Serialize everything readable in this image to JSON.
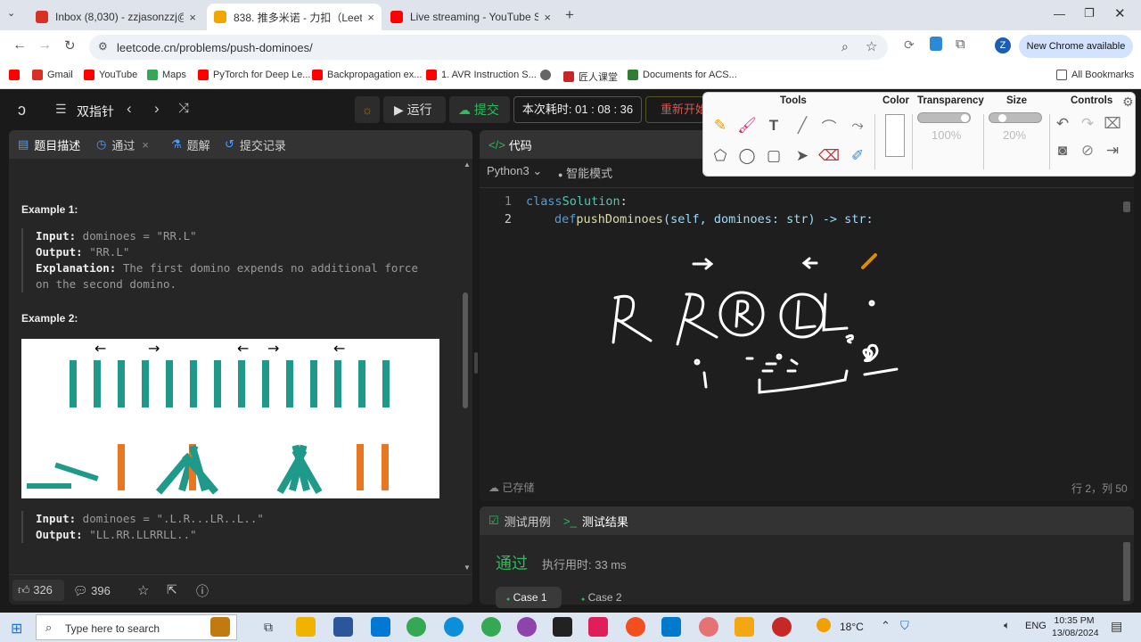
{
  "browser": {
    "tabs": [
      {
        "title": "Inbox (8,030) - zzjasonzzj@gmai",
        "color": "#d93025"
      },
      {
        "title": "838. 推多米诺 - 力扣（LeetCode）",
        "color": "#f0a500"
      },
      {
        "title": "Live streaming - YouTube Studio",
        "color": "#ff0000"
      }
    ],
    "url": "leetcode.cn/problems/push-dominoes/",
    "new_chrome": "New Chrome available",
    "profile": "Z",
    "bookmarks": [
      "Gmail",
      "YouTube",
      "Maps",
      "PyTorch for Deep Le...",
      "Backpropagation ex...",
      "1. AVR Instruction S...",
      "",
      "匠人课堂",
      "Documents for ACS..."
    ],
    "all_bookmarks": "All Bookmarks"
  },
  "nav": {
    "list": "双指针",
    "run": "运行",
    "submit": "提交",
    "timer": "本次耗时: 01 : 08 : 36",
    "restart": "重新开始"
  },
  "left": {
    "tabs": [
      "题目描述",
      "通过",
      "题解",
      "提交记录"
    ],
    "ex1_title": "Example 1:",
    "ex1": {
      "input_label": "Input:",
      "input": " dominoes = \"RR.L\"",
      "output_label": "Output:",
      "output": " \"RR.L\"",
      "expl_label": "Explanation:",
      "expl1": " The first domino expends no additional force",
      "expl2": "on the second domino."
    },
    "ex2_title": "Example 2:",
    "ex2": {
      "input_label": "Input:",
      "input": " dominoes = \".L.R...LR..L..\"",
      "output_label": "Output:",
      "output": " \"LL.RR.LLRRLL..\""
    },
    "likes": "326",
    "comments": "396"
  },
  "editor": {
    "tab": "代码",
    "lang": "Python3",
    "mode": "智能模式",
    "lines": [
      {
        "n": "1",
        "kw": "class",
        "name": " Solution",
        "rest": ":"
      },
      {
        "n": "2",
        "kw": "def",
        "name": " pushDominoes",
        "rest": "(self, dominoes: str) -> str:"
      }
    ],
    "saved": "已存储",
    "cursor": "行 2，列 50"
  },
  "bottom": {
    "tab1": "测试用例",
    "tab2": "测试结果",
    "status": "通过",
    "runtime": "执行用时: 33 ms",
    "case1": "Case 1",
    "case2": "Case 2"
  },
  "annotate": {
    "tools": "Tools",
    "color": "Color",
    "transparency": "Transparency",
    "size": "Size",
    "controls": "Controls",
    "trans_val": "100%",
    "size_val": "20%"
  },
  "figure": {
    "top_arrows": [
      "←",
      "→",
      "←",
      "→",
      "←"
    ],
    "before_count": 14,
    "colors": {
      "green": "#1f9a8a",
      "orange": "#e87722"
    }
  },
  "taskbar": {
    "search": "Type here to search",
    "temp": "18°C",
    "lang": "ENG",
    "time": "10:35 PM",
    "date": "13/08/2024"
  }
}
